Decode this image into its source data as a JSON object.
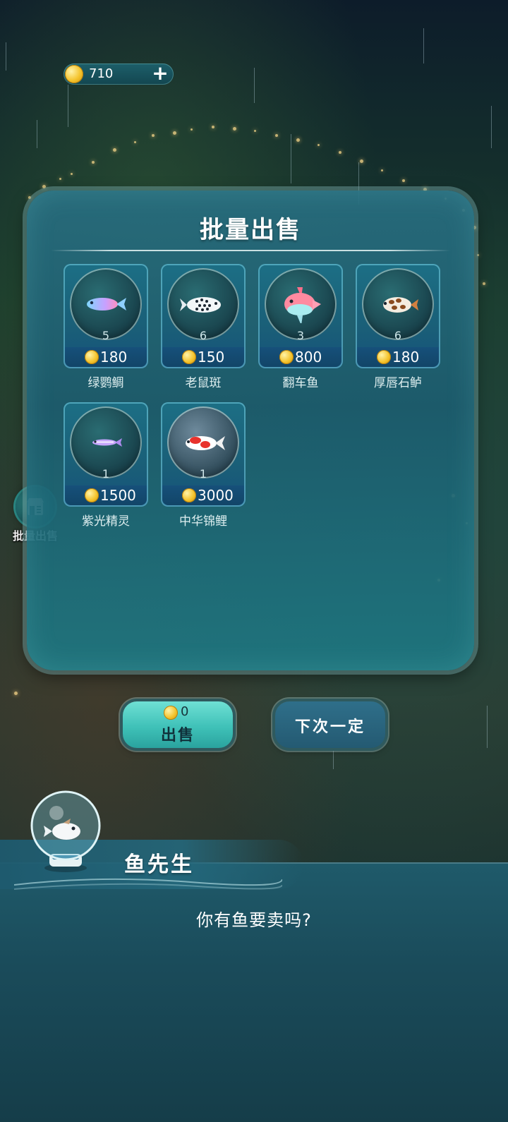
{
  "currency": {
    "amount": "710",
    "add_symbol": "+",
    "icon": "gold-coin-icon"
  },
  "side_shortcut": {
    "label": "批量出售",
    "icon": "shop-icon"
  },
  "panel": {
    "title": "批量出售",
    "fish": [
      {
        "name": "绿鹦鲷",
        "quantity": "5",
        "price": "180",
        "icon": "parrotfish-icon"
      },
      {
        "name": "老鼠斑",
        "quantity": "6",
        "price": "150",
        "icon": "spotted-grouper-icon"
      },
      {
        "name": "翻车鱼",
        "quantity": "3",
        "price": "800",
        "icon": "sunfish-icon"
      },
      {
        "name": "厚唇石鲈",
        "quantity": "6",
        "price": "180",
        "icon": "sweetlips-icon"
      },
      {
        "name": "紫光精灵",
        "quantity": "1",
        "price": "1500",
        "icon": "neon-fish-icon"
      },
      {
        "name": "中华锦鲤",
        "quantity": "1",
        "price": "3000",
        "icon": "koi-icon"
      }
    ]
  },
  "buttons": {
    "sell_amount": "0",
    "sell_label": "出售",
    "later_label": "下次一定"
  },
  "dialog": {
    "speaker": "鱼先生",
    "text": "你有鱼要卖吗?"
  },
  "colors": {
    "panel": "#1c5c6e",
    "sell_button": "#3fc1b8",
    "later_button": "#245a72",
    "coin": "#f4c32b"
  }
}
